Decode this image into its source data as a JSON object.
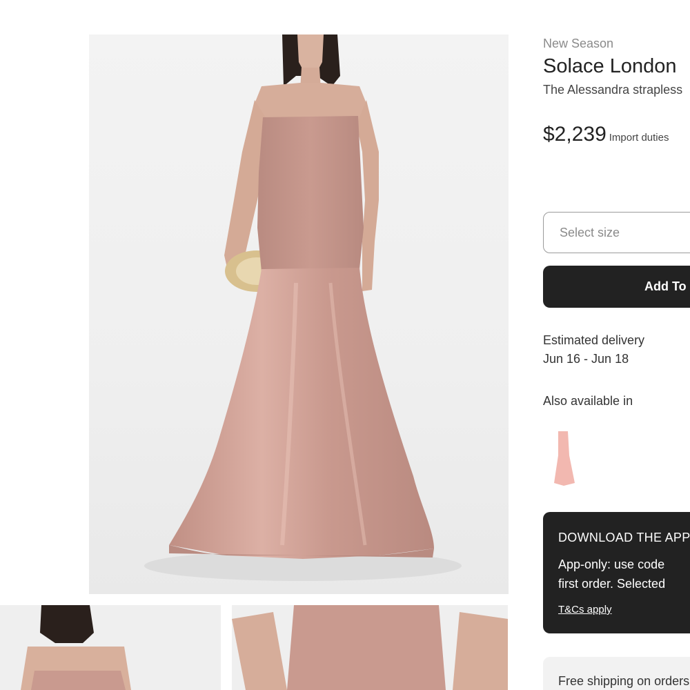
{
  "product": {
    "season": "New Season",
    "brand": "Solace London",
    "description": "The Alessandra strapless",
    "price": "$2,239",
    "duties_note": "Import duties"
  },
  "purchase": {
    "size_placeholder": "Select size",
    "add_button_label": "Add To"
  },
  "delivery": {
    "label": "Estimated delivery",
    "dates": "Jun 16 - Jun 18"
  },
  "also_available": {
    "label": "Also available in"
  },
  "promo": {
    "title": "DOWNLOAD THE APP",
    "line1": "App-only: use code",
    "line2": "first order. Selected",
    "link": "T&Cs apply"
  },
  "shipping": {
    "text": "Free shipping on orders"
  },
  "colors": {
    "dress": "#c99a8e",
    "button": "#222222",
    "background": "#ffffff"
  }
}
